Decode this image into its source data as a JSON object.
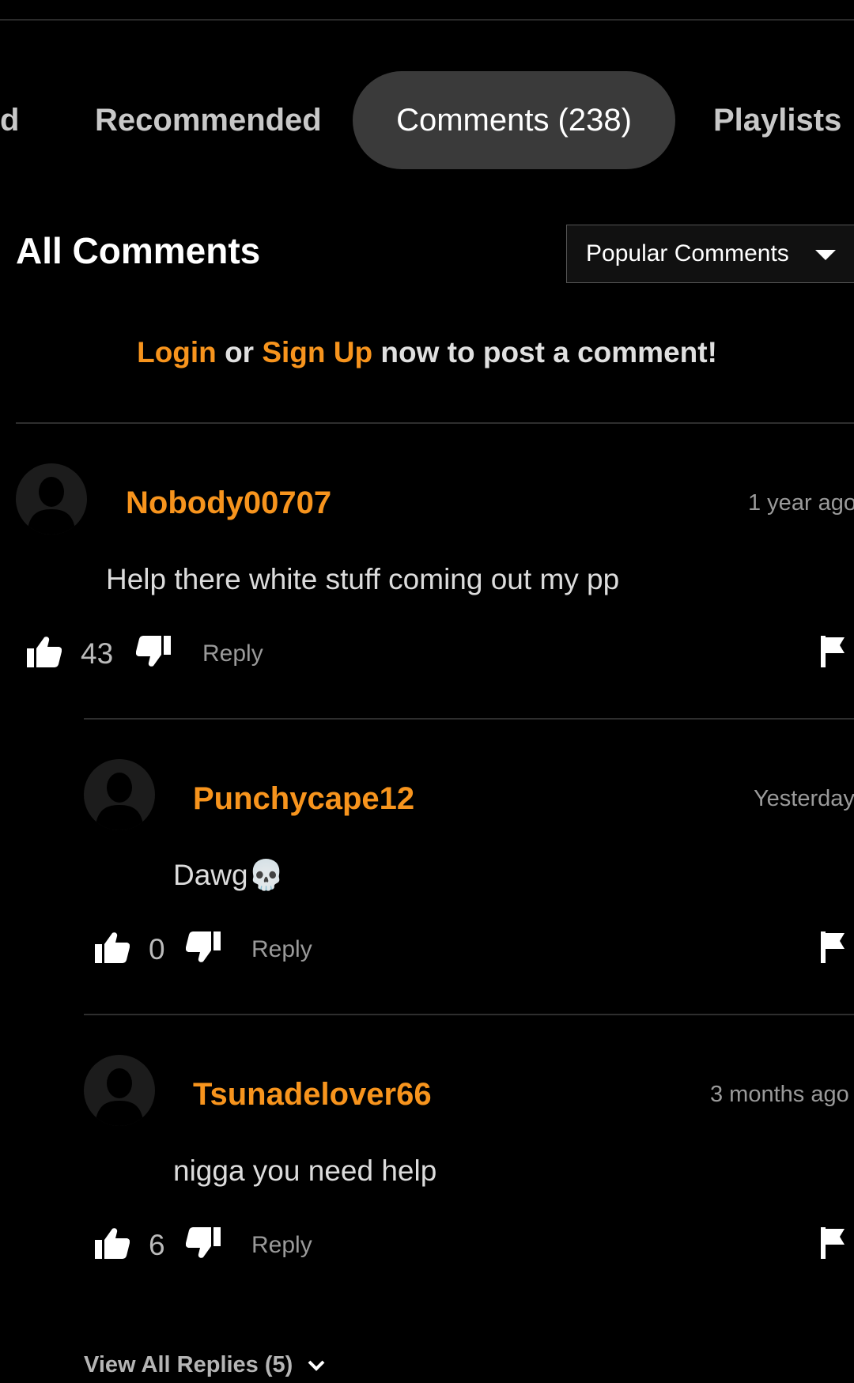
{
  "tabs": [
    {
      "label": "d"
    },
    {
      "label": "Recommended"
    },
    {
      "label": "Comments (238)"
    },
    {
      "label": "Playlists"
    }
  ],
  "header": {
    "title": "All Comments",
    "sort_selected": "Popular Comments"
  },
  "login_prompt": {
    "login": "Login",
    "or": "or",
    "signup": "Sign Up",
    "rest": "now to post a comment!"
  },
  "comments": [
    {
      "user": "Nobody00707",
      "time": "1 year ago",
      "text": "Help there white stuff coming out my pp",
      "likes": "43",
      "reply": "Reply"
    },
    {
      "user": "Punchycape12",
      "time": "Yesterday",
      "text": "Dawg💀",
      "likes": "0",
      "reply": "Reply"
    },
    {
      "user": "Tsunadelover66",
      "time": "3 months ago",
      "text": "nigga you need help",
      "likes": "6",
      "reply": "Reply"
    }
  ],
  "view_all_replies": "View All Replies (5)",
  "colors": {
    "accent": "#f7941d",
    "background": "#000000",
    "tab_active": "#3a3a3a"
  }
}
